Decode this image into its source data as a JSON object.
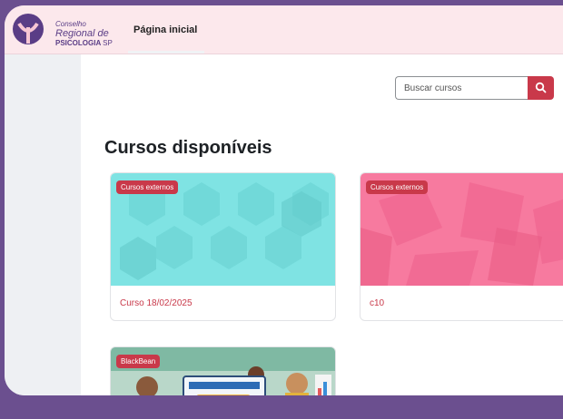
{
  "brand": {
    "line1": "Conselho",
    "line2": "Regional de",
    "line3": "PSICOLOGIA",
    "line3_suffix": "SP"
  },
  "nav": {
    "home": "Página inicial"
  },
  "search": {
    "placeholder": "Buscar cursos"
  },
  "main": {
    "title": "Cursos disponíveis"
  },
  "courses": [
    {
      "badge": "Cursos externos",
      "name": "Curso 18/02/2025"
    },
    {
      "badge": "Cursos externos",
      "name": "c10"
    },
    {
      "badge": "BlackBean",
      "name": ""
    }
  ],
  "colors": {
    "accent": "#c9394a",
    "brand": "#5a3d86",
    "card1_bg": "#7fe3e3",
    "card2_bg": "#f77a9f"
  },
  "icons": {
    "search": "search-icon",
    "logo": "brand-logo"
  }
}
